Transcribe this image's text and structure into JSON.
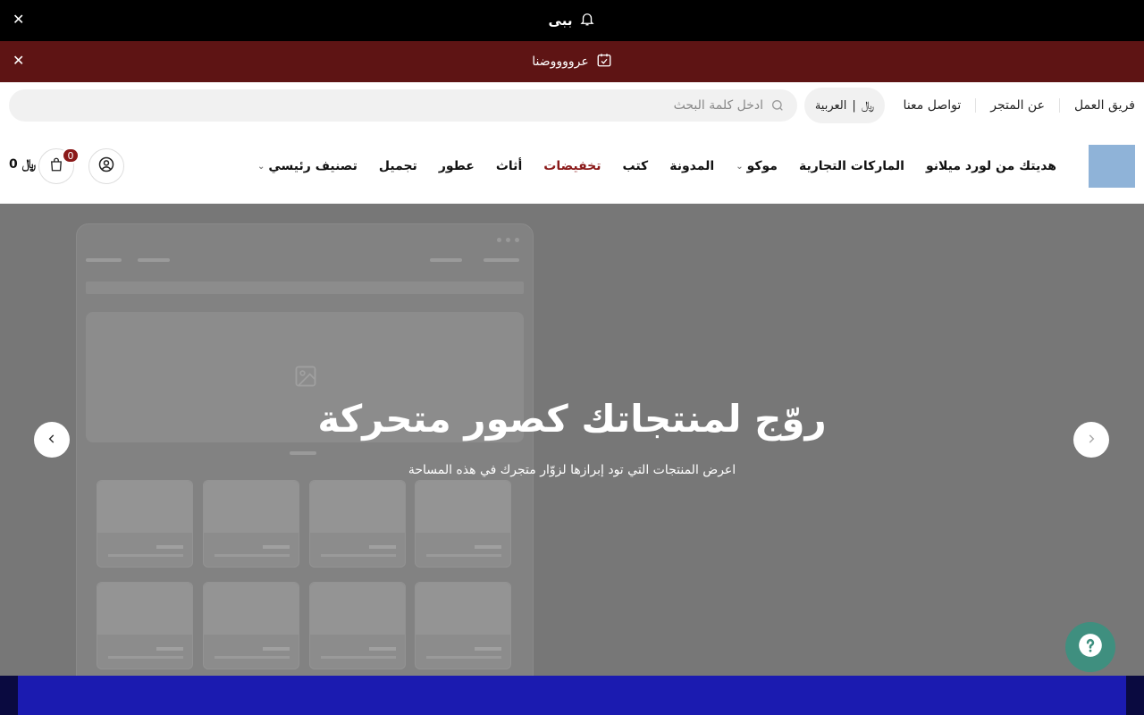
{
  "announcement": {
    "text": "ببى",
    "close": "✕"
  },
  "promo": {
    "text": "عرووووضنا",
    "close": "✕"
  },
  "utility_links": [
    "فريق العمل",
    "عن المتجر",
    "تواصل معنا"
  ],
  "language": {
    "label": "العربية",
    "currency_symbol": "﷼"
  },
  "search": {
    "placeholder": "ادخل كلمة البحث"
  },
  "nav": [
    {
      "label": "هديتك من لورد ميلانو",
      "dropdown": false
    },
    {
      "label": "الماركات التجارية",
      "dropdown": false
    },
    {
      "label": "موكو",
      "dropdown": true
    },
    {
      "label": "المدونة",
      "dropdown": false
    },
    {
      "label": "كتب",
      "dropdown": false
    },
    {
      "label": "تخفيضات",
      "dropdown": false,
      "highlight": true
    },
    {
      "label": "أثاث",
      "dropdown": false
    },
    {
      "label": "عطور",
      "dropdown": false
    },
    {
      "label": "تجميل",
      "dropdown": false
    },
    {
      "label": "تصنيف رئيسي",
      "dropdown": true
    }
  ],
  "cart": {
    "count": "0",
    "total": "0 ﷼"
  },
  "hero": {
    "title": "روّج لمنتجاتك كصور متحركة",
    "subtitle": "اعرض المنتجات التي تود إبرازها لزوّار متجرك في هذه المساحة"
  },
  "colors": {
    "sale": "#8b1a1a",
    "promo_bg": "#5e1414",
    "help_bg": "#3f8f7f",
    "logo": "#8fb3d8"
  },
  "icons": [
    "bell-icon",
    "calendar-check-icon",
    "search-icon",
    "user-icon",
    "cart-icon",
    "question-icon",
    "chevron-left-icon",
    "chevron-right-icon"
  ]
}
